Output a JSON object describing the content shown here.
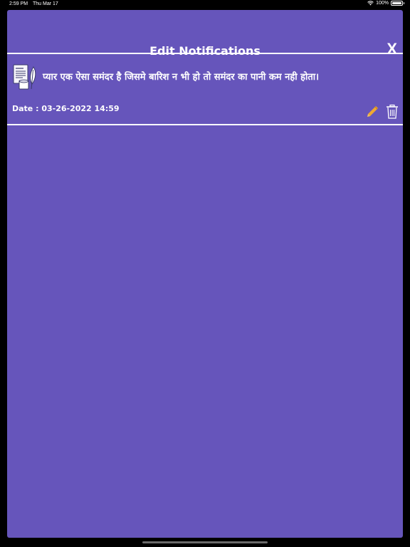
{
  "status_bar": {
    "time": "2:59 PM",
    "date": "Thu Mar 17",
    "battery": "100%"
  },
  "header": {
    "title": "Edit Notifications",
    "close_label": "X"
  },
  "notifications": [
    {
      "message": "प्यार एक ऐसा समंदर है जिसमे बारिश न भी हो तो समंदर का पानी कम नही होता।",
      "date": "Date : 03-26-2022 14:59",
      "icons": [
        "document-icon",
        "edit-pencil-icon",
        "trash-icon"
      ]
    }
  ],
  "colors": {
    "background": "#6655bb",
    "text": "#ffffff",
    "edit_icon": "#f0a830"
  }
}
